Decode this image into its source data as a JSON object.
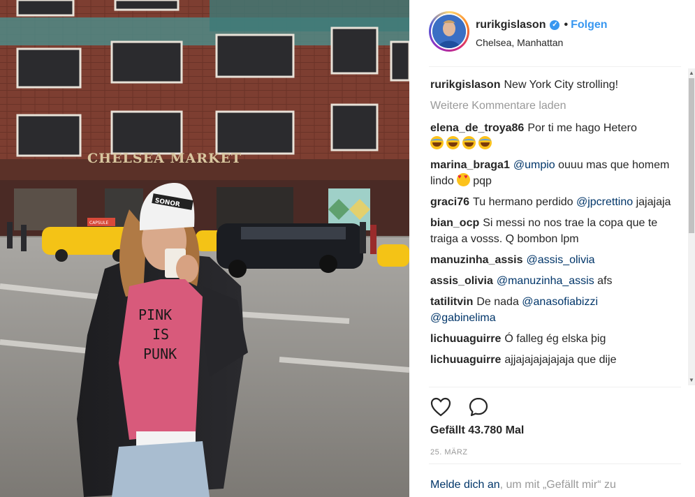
{
  "photo": {
    "market_sign": "CHELSEA MARKET",
    "taxi_sign": "CAPSULE",
    "beanie_text": "SONOR",
    "shirt_text": [
      "PINK",
      "IS",
      "PUNK"
    ]
  },
  "header": {
    "username": "rurikgislason",
    "verified_icon": "verified-check-icon",
    "separator": "•",
    "follow_label": "Folgen",
    "location": "Chelsea, Manhattan"
  },
  "caption": {
    "user": "rurikgislason",
    "text": "New York City strolling!"
  },
  "load_more": "Weitere Kommentare laden",
  "comments": [
    {
      "user": "elena_de_troya86",
      "text": "Por ti me hago Hetero"
    },
    {
      "user": "marina_braga1",
      "mention": "@umpio",
      "text": " ouuu mas que homem lindo ",
      "text2": "pqp"
    },
    {
      "user": "graci76",
      "text": "Tu hermano perdido ",
      "mention": "@jpcrettino",
      "text2": " jajajaja"
    },
    {
      "user": "bian_ocp",
      "text": "Si messi no nos trae la copa que te traiga a vosss. Q bombon lpm"
    },
    {
      "user": "manuzinha_assis",
      "mention": "@assis_olivia"
    },
    {
      "user": "assis_olivia",
      "mention": "@manuzinha_assis",
      "text": " afs"
    },
    {
      "user": "tatilitvin",
      "text": "De nada ",
      "mention": "@anasofiabizzi",
      "mention2": "@gabinelima"
    },
    {
      "user": "lichuuaguirre",
      "text": "Ó falleg ég elska þig"
    },
    {
      "user": "lichuuaguirre",
      "text": "ajjajajajajajaja que dije"
    }
  ],
  "actions": {
    "like_icon": "heart-outline-icon",
    "comment_icon": "comment-bubble-icon"
  },
  "likes": "Gefällt 43.780 Mal",
  "date": "25. MÄRZ",
  "login": {
    "link": "Melde dich an",
    "text": ", um mit „Gefällt mir“ zu"
  },
  "colors": {
    "link": "#003569",
    "follow": "#3897f0",
    "muted": "#999999"
  }
}
